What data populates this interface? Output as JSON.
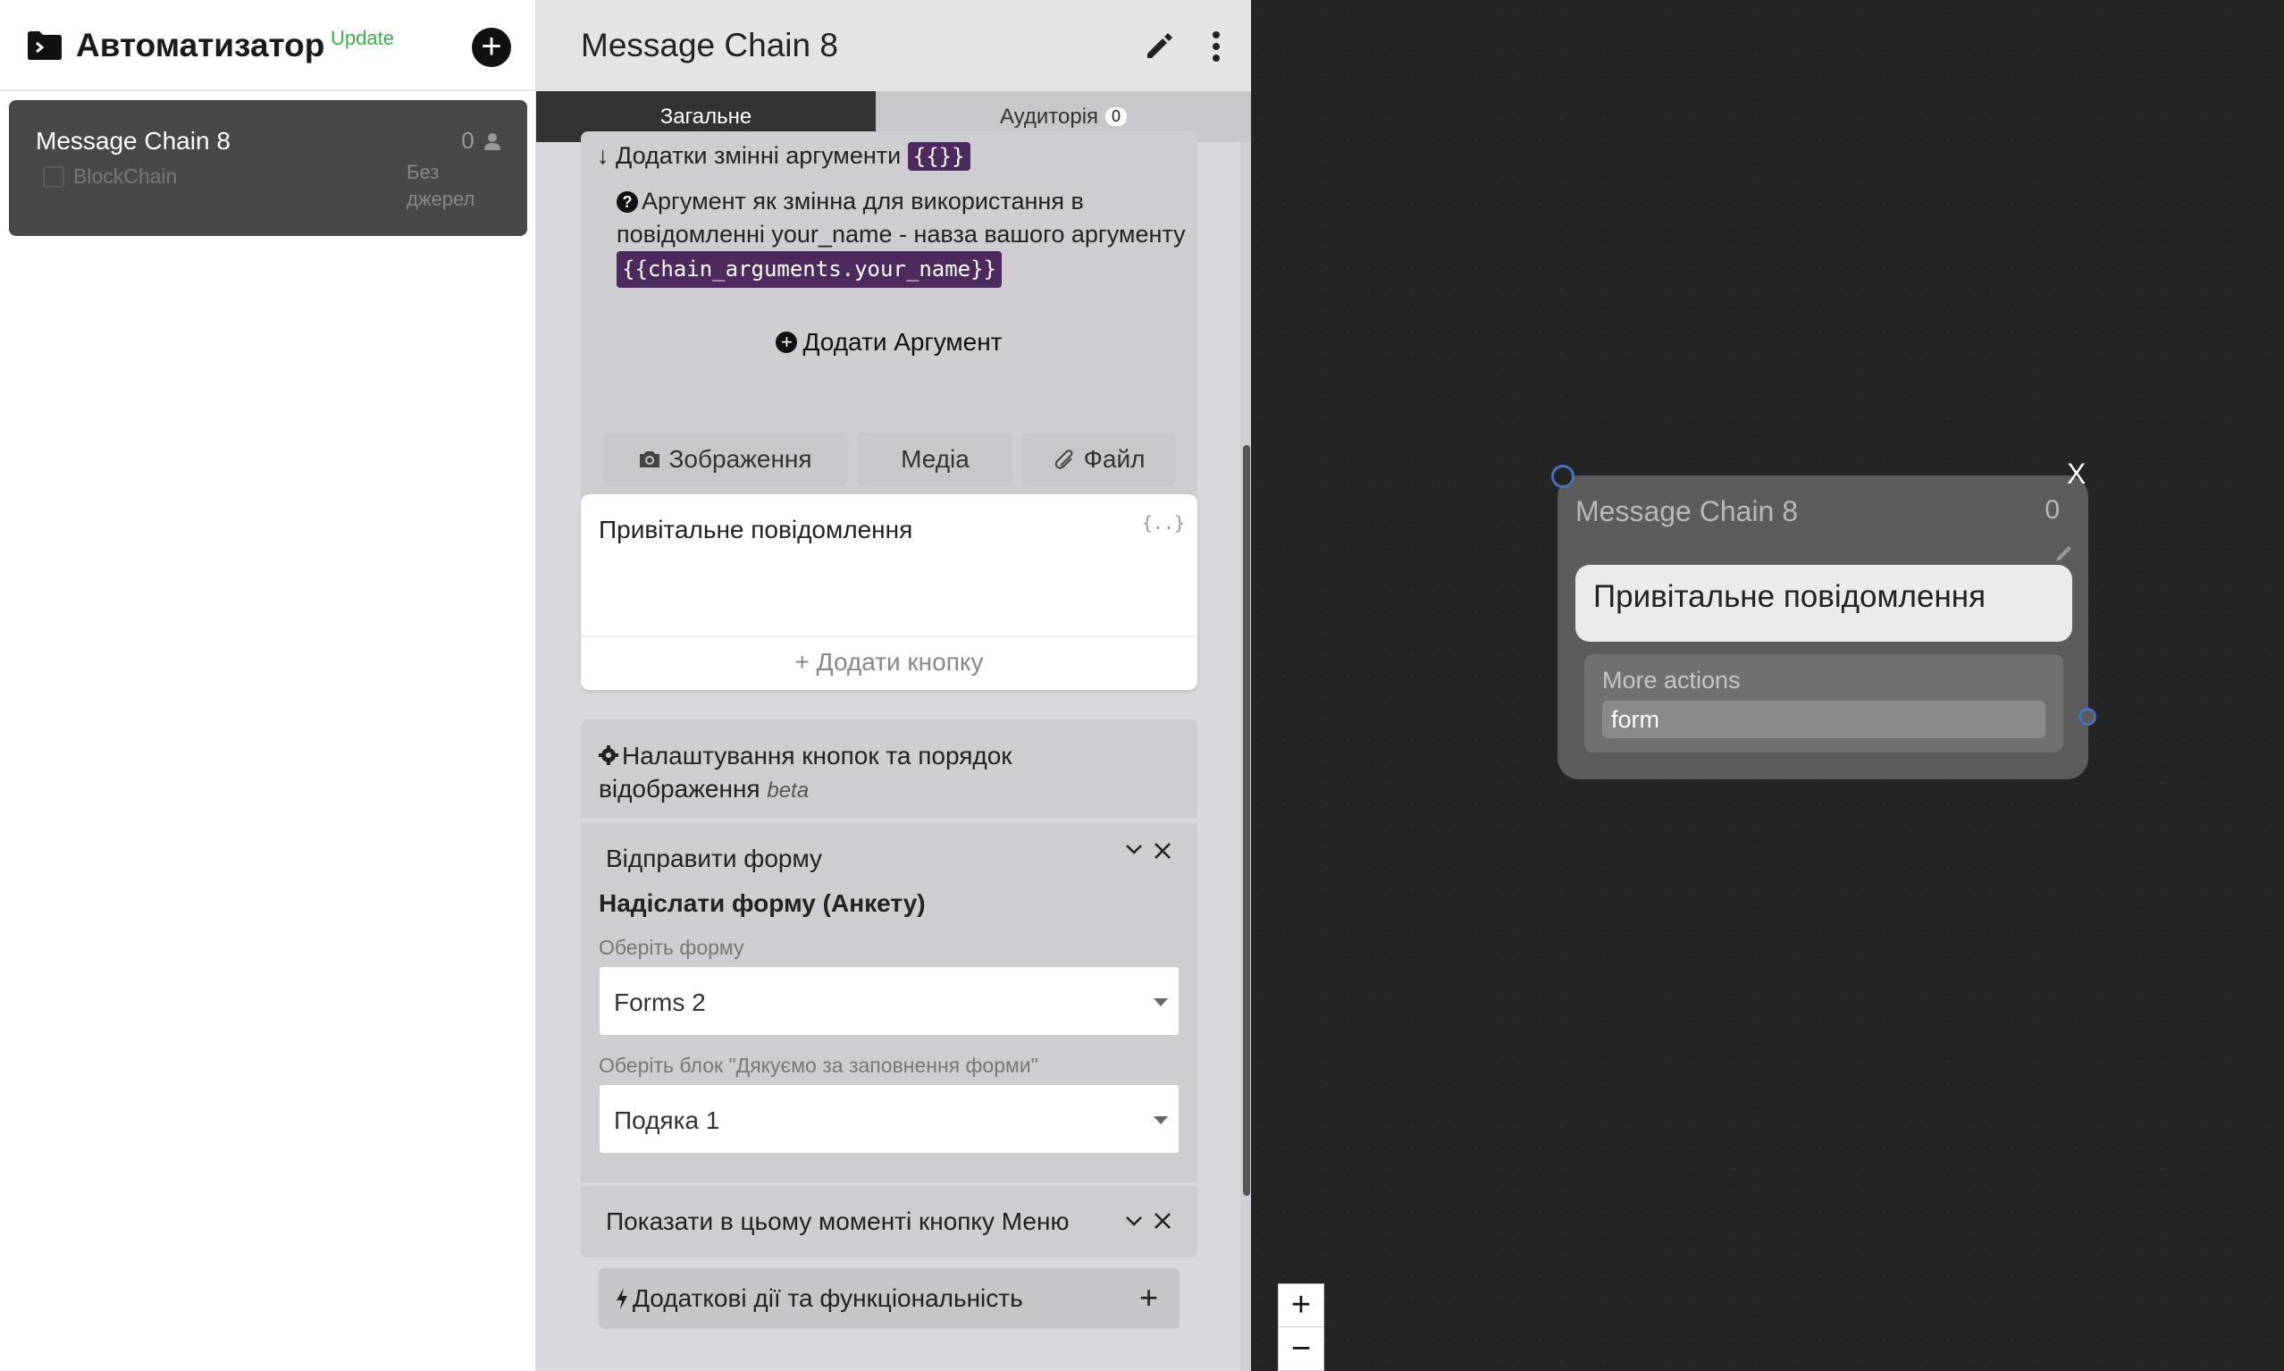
{
  "app": {
    "title": "Автоматизатор",
    "update_label": "Update",
    "add_label": "+"
  },
  "sidebar": {
    "chains": [
      {
        "name": "Message Chain 8",
        "count": "0",
        "type": "BlockChain",
        "source": "Без джерел"
      }
    ]
  },
  "panel": {
    "title": "Message Chain 8",
    "tabs": [
      {
        "label": "Загальне"
      },
      {
        "label": "Аудиторія",
        "badge": "0"
      }
    ],
    "args": {
      "header": "Додатки змінні аргументи",
      "header_code": "{{}}",
      "help": "Аргумент як змінна для використання в повідомленні your_name - навза вашого аргументу",
      "help_code": "{{chain_arguments.your_name}}",
      "add_label": "Додати Аргумент"
    },
    "media_buttons": {
      "image": "Зображення",
      "media": "Медіа",
      "file": "Файл"
    },
    "message": {
      "text": "Привітальне повідомлення",
      "var_hint": "{..}",
      "add_button": "+ Додати кнопку"
    },
    "settings": {
      "text": "Налаштування кнопок та порядок відображення",
      "beta": "beta"
    },
    "form_action": {
      "title": "Відправити форму",
      "subtitle": "Надіслати форму (Анкету)",
      "form_label": "Оберіть форму",
      "form_value": "Forms 2",
      "thanks_label": "Оберіть блок \"Дякуємо за заповнення форми\"",
      "thanks_value": "Подяка 1"
    },
    "menu_action": {
      "title": "Показати в цьому моменті кнопку Меню"
    },
    "extra": {
      "label": "Додаткові дії та функціональність",
      "plus": "+"
    }
  },
  "canvas": {
    "node": {
      "close": "X",
      "title": "Message Chain 8",
      "count": "0",
      "message": "Привітальне повідомлення",
      "actions_label": "More actions",
      "action_item": "form"
    },
    "zoom": {
      "in": "+",
      "out": "−"
    }
  }
}
